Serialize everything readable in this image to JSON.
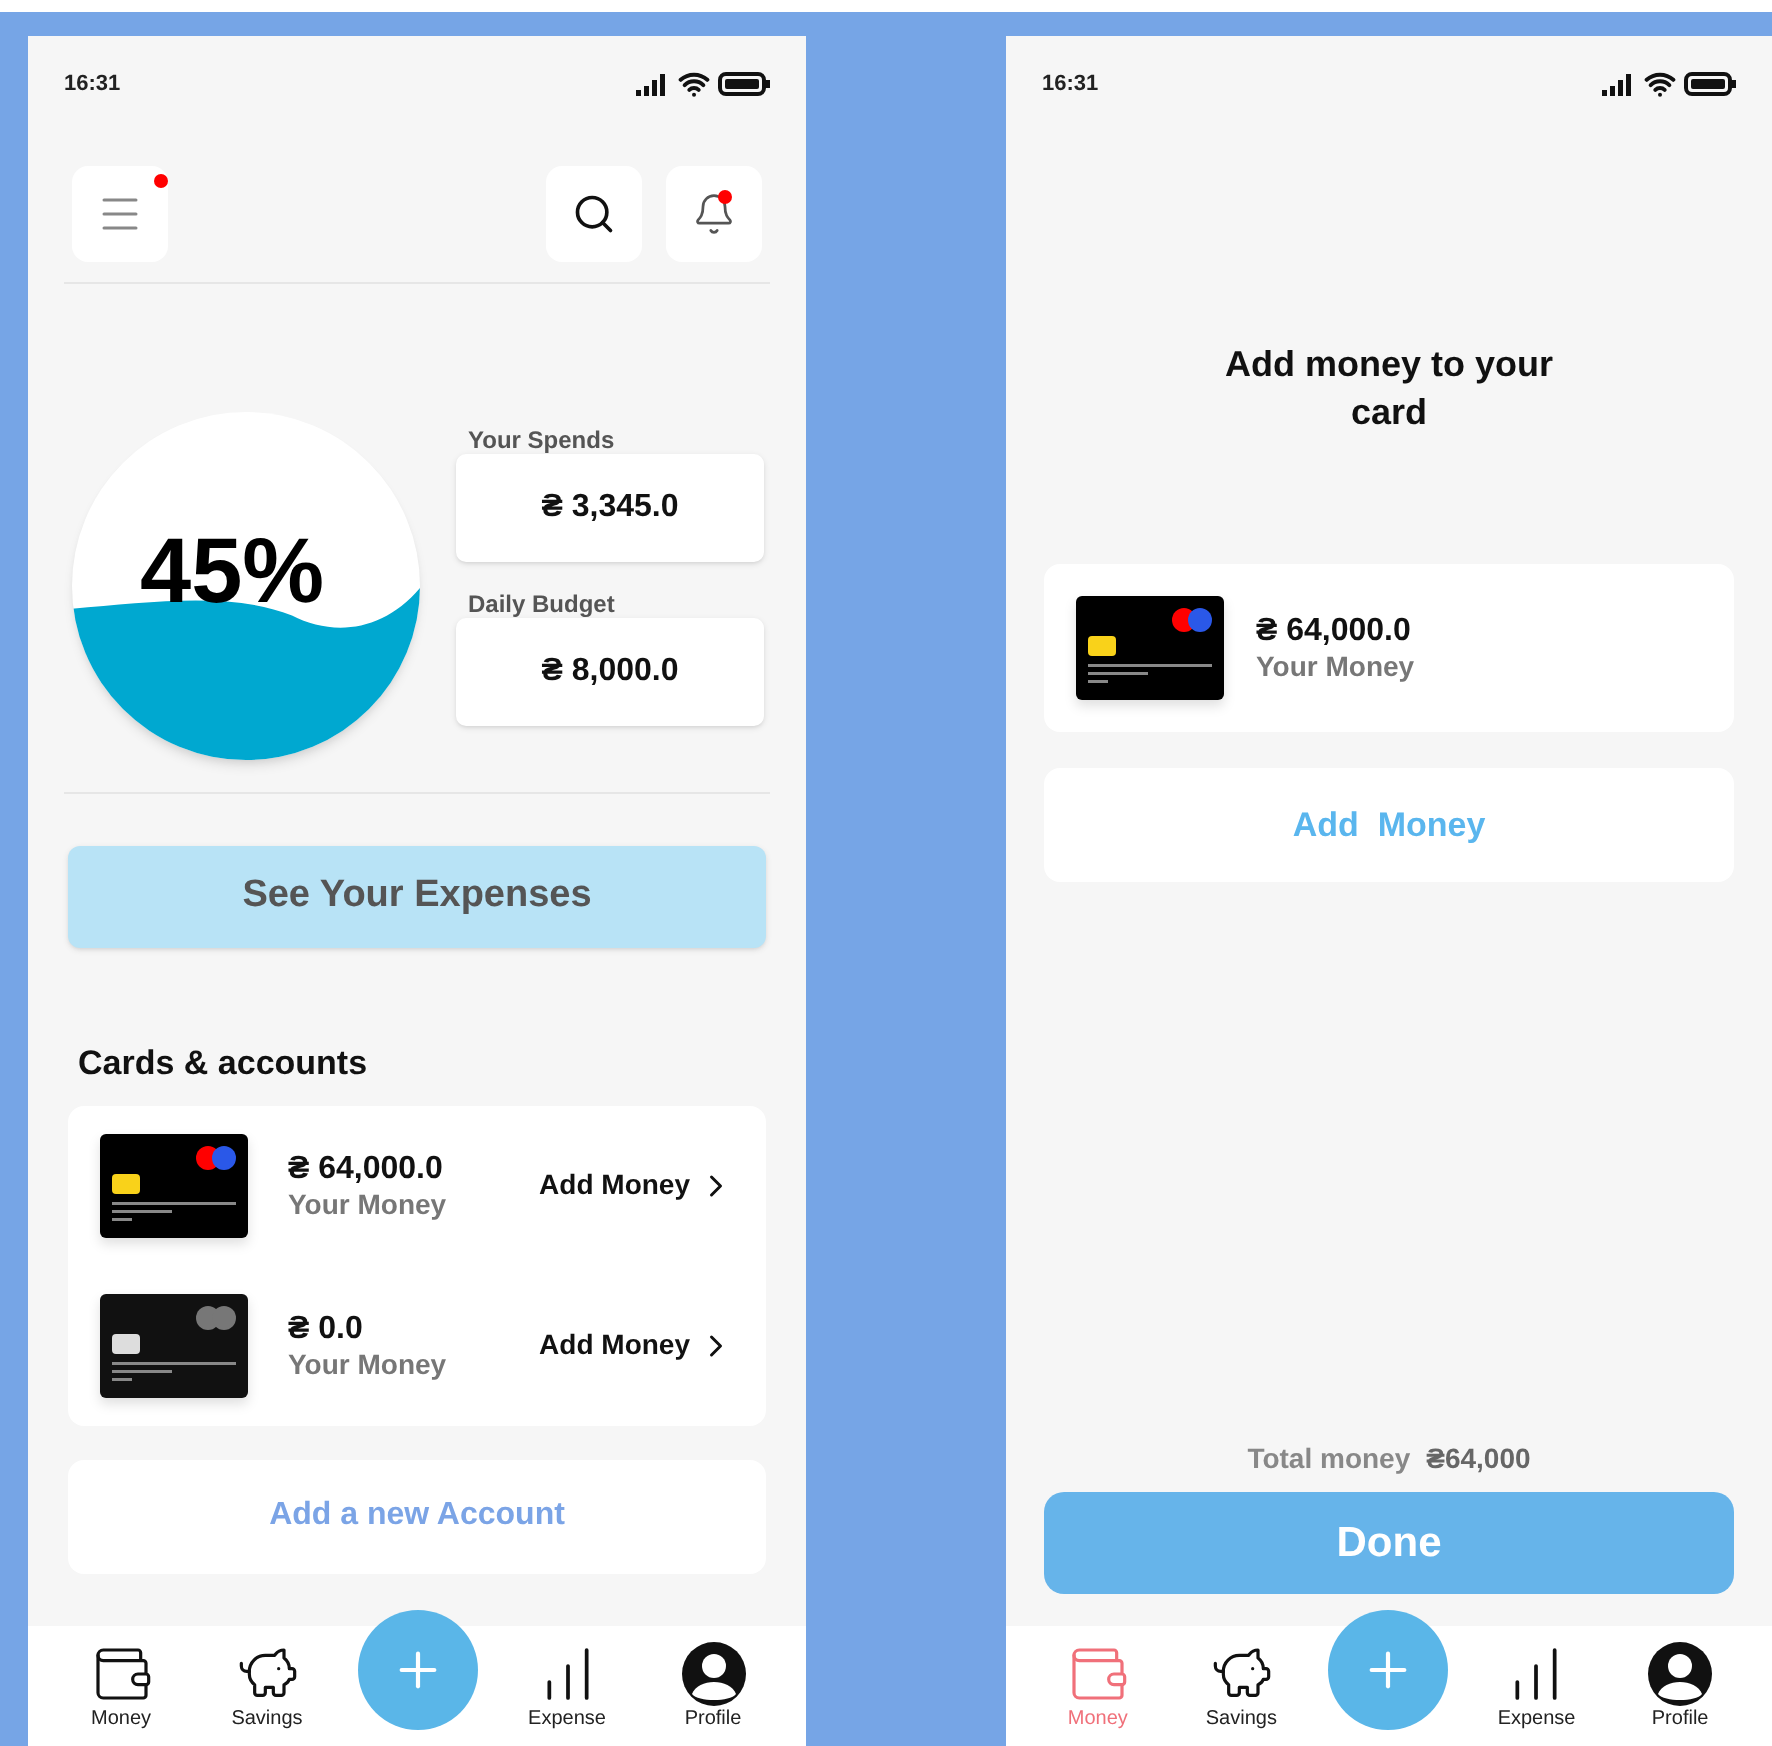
{
  "home": {
    "status_time": "16:31",
    "header_buttons": [
      {
        "kind": "menu",
        "dot": true
      },
      {
        "kind": "search"
      },
      {
        "kind": "bell",
        "dot": true
      }
    ],
    "gauge": {
      "label": "45%"
    },
    "stats": [
      {
        "label": "Your Spends",
        "value": "₴ 3,345.0"
      },
      {
        "label": "Daily Budget",
        "value": "₴ 8,000.0"
      }
    ],
    "expenses_button": "See Your Expenses",
    "section_title": "Cards & accounts",
    "cards": [
      {
        "amount": "₴ 64,000.0",
        "caption": "Your Money",
        "action": "Add Money",
        "active": true
      },
      {
        "amount": "₴ 0.0",
        "caption": "Your Money",
        "action": "Add Money",
        "active": false
      }
    ],
    "add_account": "Add a new Account",
    "nav": [
      {
        "kind": "wallet",
        "label": "Money",
        "selected": false
      },
      {
        "kind": "piggy",
        "label": "Savings",
        "selected": false
      },
      {
        "kind": "plus"
      },
      {
        "kind": "chart",
        "label": "Expense",
        "selected": false
      },
      {
        "kind": "profile",
        "label": "Profile",
        "selected": false
      }
    ]
  },
  "add_money": {
    "status_time": "16:31",
    "title": "Add money to your card",
    "card": {
      "amount": "₴ 64,000.0",
      "caption": "Your Money",
      "active": true
    },
    "add_button": "Add  Money",
    "total_label": "Total money",
    "total_value": "₴64,000",
    "done_button": "Done",
    "nav": [
      {
        "kind": "wallet",
        "label": "Money",
        "selected": true
      },
      {
        "kind": "piggy",
        "label": "Savings",
        "selected": false
      },
      {
        "kind": "plus"
      },
      {
        "kind": "chart",
        "label": "Expense",
        "selected": false
      },
      {
        "kind": "profile",
        "label": "Profile",
        "selected": false
      }
    ]
  }
}
